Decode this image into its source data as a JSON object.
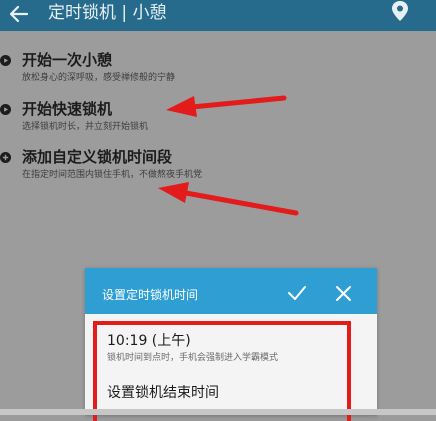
{
  "appbar": {
    "title": "定时锁机 | 小憩",
    "back_icon": "arrow-left-icon",
    "pin_icon": "location-pin-icon",
    "bg_color": "#266a8c"
  },
  "items": [
    {
      "title": "开始一次小憩",
      "subtitle": "放松身心的深呼吸，感受禅修般的宁静",
      "icon": "play-circle-icon"
    },
    {
      "title": "开始快速锁机",
      "subtitle": "选择锁机时长，并立刻开始锁机",
      "icon": "play-circle-icon"
    },
    {
      "title": "添加自定义锁机时间段",
      "subtitle": "在指定时间范围内锁住手机，不做熬夜手机党",
      "icon": "plus-circle-icon"
    }
  ],
  "dialog": {
    "title": "设置定时锁机时间",
    "ok_icon": "check-icon",
    "cancel_icon": "close-icon",
    "header_color": "#2f9ed3",
    "options": [
      {
        "title": "10:19 (上午)",
        "subtitle": "锁机时间到点时，手机会强制进入学霸模式"
      },
      {
        "title": "设置锁机结束时间",
        "subtitle": ""
      }
    ]
  },
  "annotation_color": "#e31b1b"
}
